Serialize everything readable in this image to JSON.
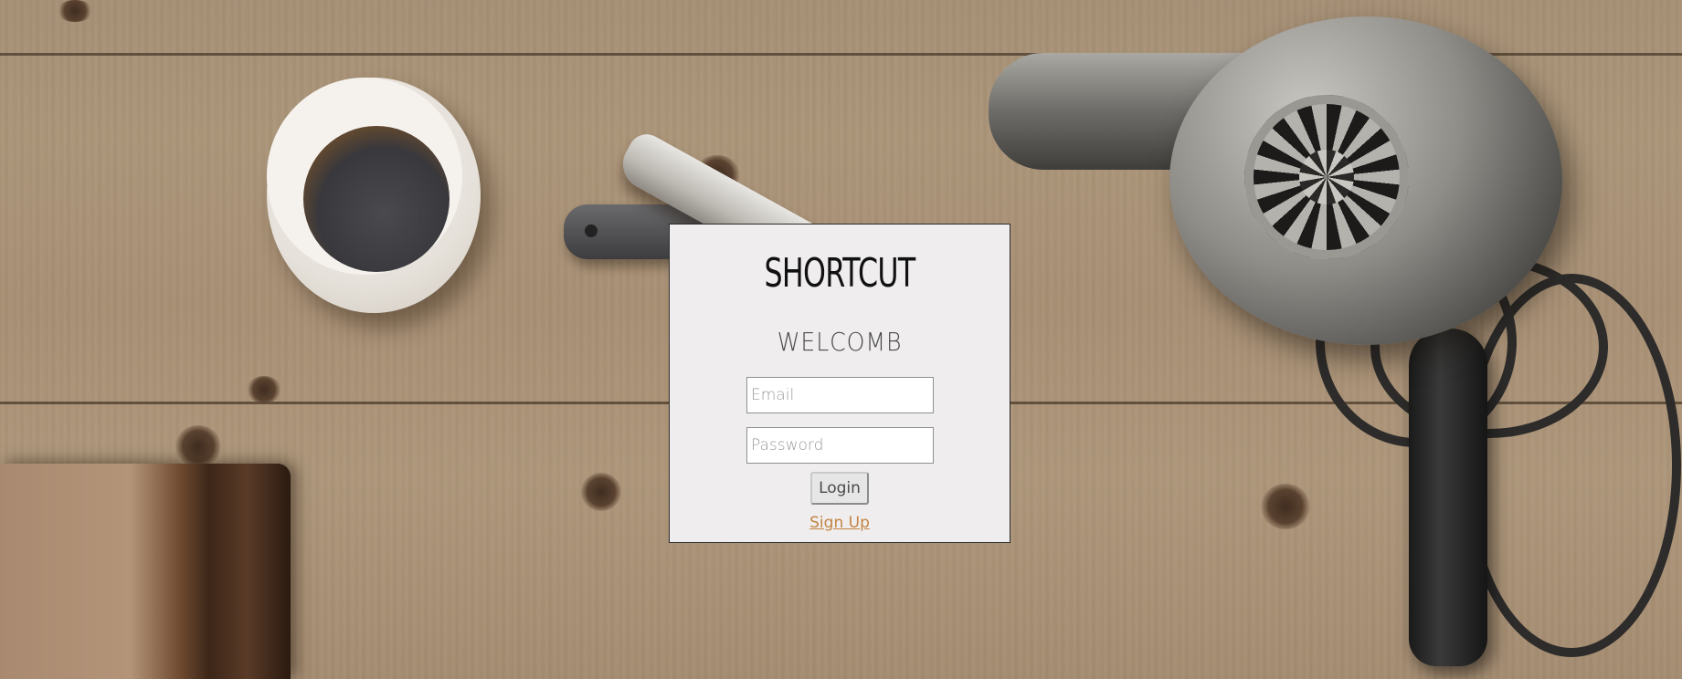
{
  "app": {
    "logo_text": "SHORTCUT",
    "welcome_text": "WELCOMB"
  },
  "login_form": {
    "email_placeholder": "Email",
    "email_value": "",
    "password_placeholder": "Password",
    "password_value": "",
    "login_button_label": "Login",
    "signup_link_label": "Sign Up"
  },
  "colors": {
    "card_background": "#efeded",
    "card_border": "#2a2a2a",
    "signup_link": "#c48443",
    "welcome_text": "#4a4a4a",
    "wood_background": "#a78f74"
  },
  "icons": {
    "background_props": [
      "coffee-cup",
      "straight-razor",
      "hair-dryer",
      "old-book"
    ]
  }
}
